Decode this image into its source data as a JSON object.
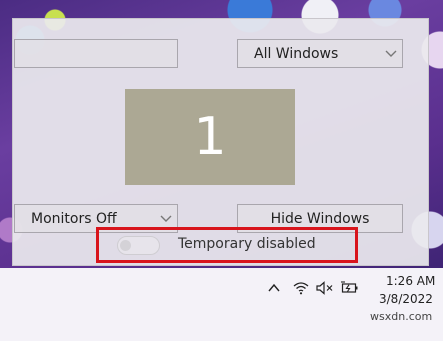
{
  "panel": {
    "left_top_dropdown": {
      "value": ""
    },
    "right_top_dropdown": {
      "value": "All Windows"
    },
    "monitor_number": "1",
    "left_bottom_dropdown": {
      "value": "Monitors Off"
    },
    "hide_windows_button": {
      "label": "Hide Windows"
    },
    "toggle": {
      "label": "Temporary disabled",
      "state": "off"
    }
  },
  "taskbar": {
    "tray_icons": [
      "chevron-up-icon",
      "wifi-icon",
      "volume-muted-icon",
      "battery-charging-icon"
    ],
    "clock": {
      "time": "1:26 AM",
      "date": "3/8/2022"
    }
  },
  "watermark": "wsxdn.com",
  "colors": {
    "highlight": "#d8141c",
    "number_box": "#aca894"
  }
}
